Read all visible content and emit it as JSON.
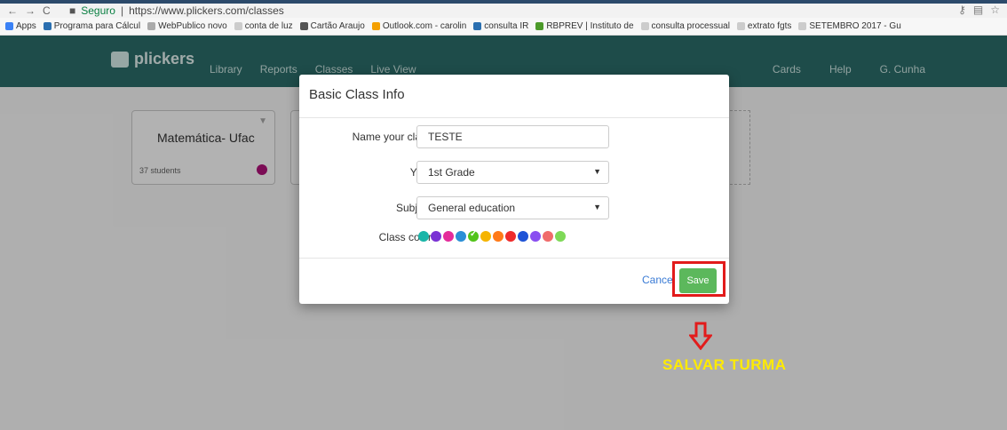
{
  "browser": {
    "secure_label": "Seguro",
    "url": "https://www.plickers.com/classes",
    "bookmarks": [
      {
        "label": "Apps"
      },
      {
        "label": "Programa para Cálcul"
      },
      {
        "label": "WebPublico novo"
      },
      {
        "label": "conta de luz"
      },
      {
        "label": "Cartão Araujo"
      },
      {
        "label": "Outlook.com - carolin"
      },
      {
        "label": "consulta IR"
      },
      {
        "label": "RBPREV | Instituto de"
      },
      {
        "label": "consulta processual"
      },
      {
        "label": "extrato fgts"
      },
      {
        "label": "SETEMBRO 2017 - Gu"
      }
    ]
  },
  "header": {
    "logo": "plickers",
    "nav": [
      "Library",
      "Reports",
      "Classes",
      "Live View"
    ],
    "right": [
      "Cards",
      "Help",
      "G. Cunha"
    ]
  },
  "cards": [
    {
      "title": "Matemática- Ufac",
      "count": "37 students",
      "color": "#b0127a"
    }
  ],
  "modal": {
    "title": "Basic Class Info",
    "fields": {
      "name_label": "Name your class",
      "name_value": "TESTE",
      "year_label": "Year",
      "year_value": "1st Grade",
      "subject_label": "Subject",
      "subject_value": "General education",
      "color_label": "Class color"
    },
    "colors": [
      "#1ab5a8",
      "#7a32d4",
      "#e42b9a",
      "#2a8fd6",
      "#52c41a",
      "#f5b400",
      "#ff7a18",
      "#ef2b2b",
      "#1e53d6",
      "#8a4ef0",
      "#f06b6b",
      "#7ed957"
    ],
    "cancel": "Cancel",
    "save": "Save"
  },
  "annotation": "SALVAR TURMA"
}
